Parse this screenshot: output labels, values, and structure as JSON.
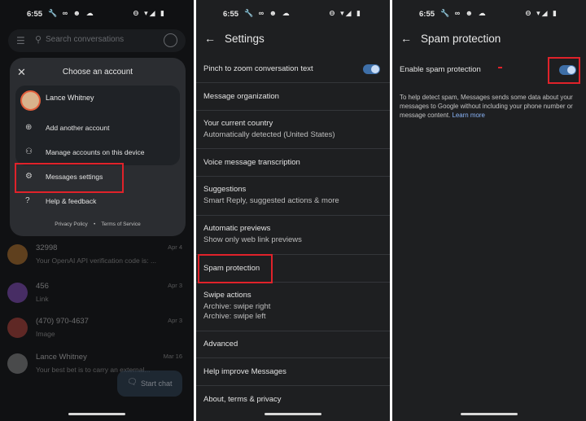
{
  "status_bar": {
    "time": "6:55",
    "left_icons": "🔧 ∞ ☻ ☁",
    "right_icons": "⊖ ▾◢ ▮"
  },
  "panel1": {
    "search": {
      "placeholder": "Search conversations"
    },
    "account_sheet": {
      "title": "Choose an account",
      "account_name": "Lance Whitney",
      "items": [
        {
          "label": "Add another account",
          "icon": "add-person-icon"
        },
        {
          "label": "Manage accounts on this device",
          "icon": "manage-accounts-icon"
        },
        {
          "label": "Messages settings",
          "icon": "gear-icon"
        },
        {
          "label": "Help & feedback",
          "icon": "help-icon"
        }
      ],
      "privacy_policy": "Privacy Policy",
      "separator": "•",
      "terms": "Terms of Service"
    },
    "conversations": [
      {
        "name": "32998",
        "preview": "Your OpenAI API verification code is: ...",
        "date": "Apr 4",
        "color": "#c07a2c"
      },
      {
        "name": "456",
        "preview": "Link",
        "date": "Apr 3",
        "color": "#8a4fc7"
      },
      {
        "name": "(470) 970-4637",
        "preview": "Image",
        "date": "Apr 3",
        "color": "#c0453c"
      },
      {
        "name": "Lance Whitney",
        "preview": "Your best bet is to carry an external...",
        "date": "Mar 16",
        "color": "#8f8f8f"
      }
    ],
    "start_chat": "Start chat"
  },
  "panel2": {
    "title": "Settings",
    "rows": [
      {
        "line1": "Pinch to zoom conversation text",
        "line2": ""
      },
      {
        "line1": "Message organization",
        "line2": ""
      },
      {
        "line1": "Your current country",
        "line2": "Automatically detected (United States)"
      },
      {
        "line1": "Voice message transcription",
        "line2": ""
      },
      {
        "line1": "Suggestions",
        "line2": "Smart Reply, suggested actions & more"
      },
      {
        "line1": "Automatic previews",
        "line2": "Show only web link previews"
      },
      {
        "line1": "Spam protection",
        "line2": ""
      },
      {
        "line1": "Swipe actions",
        "line2": "Archive: swipe right",
        "line3": "Archive: swipe left"
      },
      {
        "line1": "Advanced",
        "line2": ""
      },
      {
        "line1": "Help improve Messages",
        "line2": ""
      },
      {
        "line1": "About, terms & privacy",
        "line2": ""
      }
    ]
  },
  "panel3": {
    "title": "Spam protection",
    "toggle_label": "Enable spam protection",
    "description": "To help detect spam, Messages sends some data about your messages to Google without including your phone number or message content.",
    "learn_more": "Learn more"
  },
  "colors": {
    "accent": "#3e6fa8",
    "highlight": "#e0222a",
    "link": "#8ab4f8"
  }
}
